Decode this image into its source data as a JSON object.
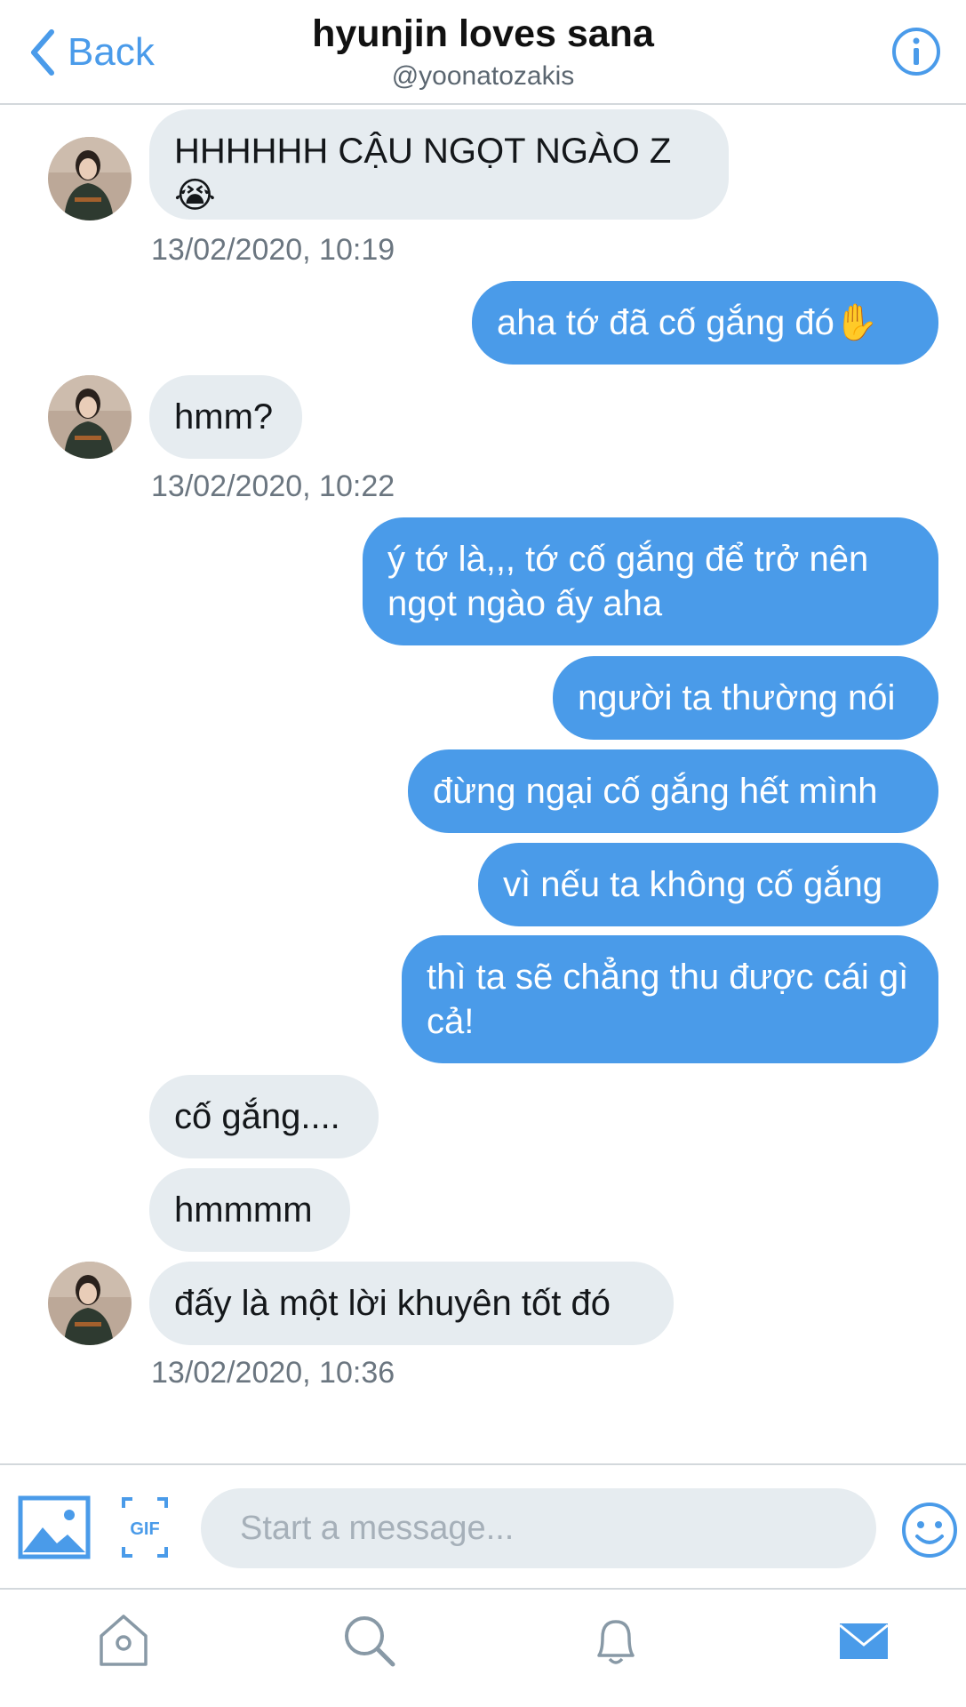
{
  "header": {
    "back_label": "Back",
    "title": "hyunjin loves sana",
    "handle": "@yoonatozakis"
  },
  "messages": [
    {
      "side": "in",
      "text": "HHHHHH CẬU NGỌT NGÀO Z",
      "emoji": "😭"
    },
    {
      "side": "in",
      "timestamp": "13/02/2020, 10:19"
    },
    {
      "side": "out",
      "text": "aha tớ đã cố gắng đó",
      "emoji": "✋"
    },
    {
      "side": "in",
      "text": "hmm?"
    },
    {
      "side": "in",
      "timestamp": "13/02/2020, 10:22"
    },
    {
      "side": "out",
      "text": "ý tớ là,,, tớ cố gắng để trở nên ngọt ngào ấy aha"
    },
    {
      "side": "out",
      "text": "người ta thường nói"
    },
    {
      "side": "out",
      "text": "đừng ngại cố gắng hết mình"
    },
    {
      "side": "out",
      "text": "vì nếu ta không cố gắng"
    },
    {
      "side": "out",
      "text": "thì ta sẽ chẳng thu được cái gì cả!"
    },
    {
      "side": "in",
      "text": "cố gắng...."
    },
    {
      "side": "in",
      "text": "hmmmm"
    },
    {
      "side": "in",
      "text": "đấy là một lời khuyên tốt đó"
    },
    {
      "side": "in",
      "timestamp": "13/02/2020, 10:36"
    }
  ],
  "composer": {
    "placeholder": "Start a message...",
    "icons": [
      "image-icon",
      "gif-icon",
      "emoji-icon"
    ]
  },
  "tabbar": {
    "icons": [
      "home-icon",
      "search-icon",
      "bell-icon",
      "mail-icon"
    ],
    "active": "mail-icon"
  },
  "colors": {
    "accent": "#4a9be9",
    "incoming_bubble": "#e6ecf0",
    "timestamp": "#6b7680",
    "icon_inactive": "#8899a6"
  }
}
